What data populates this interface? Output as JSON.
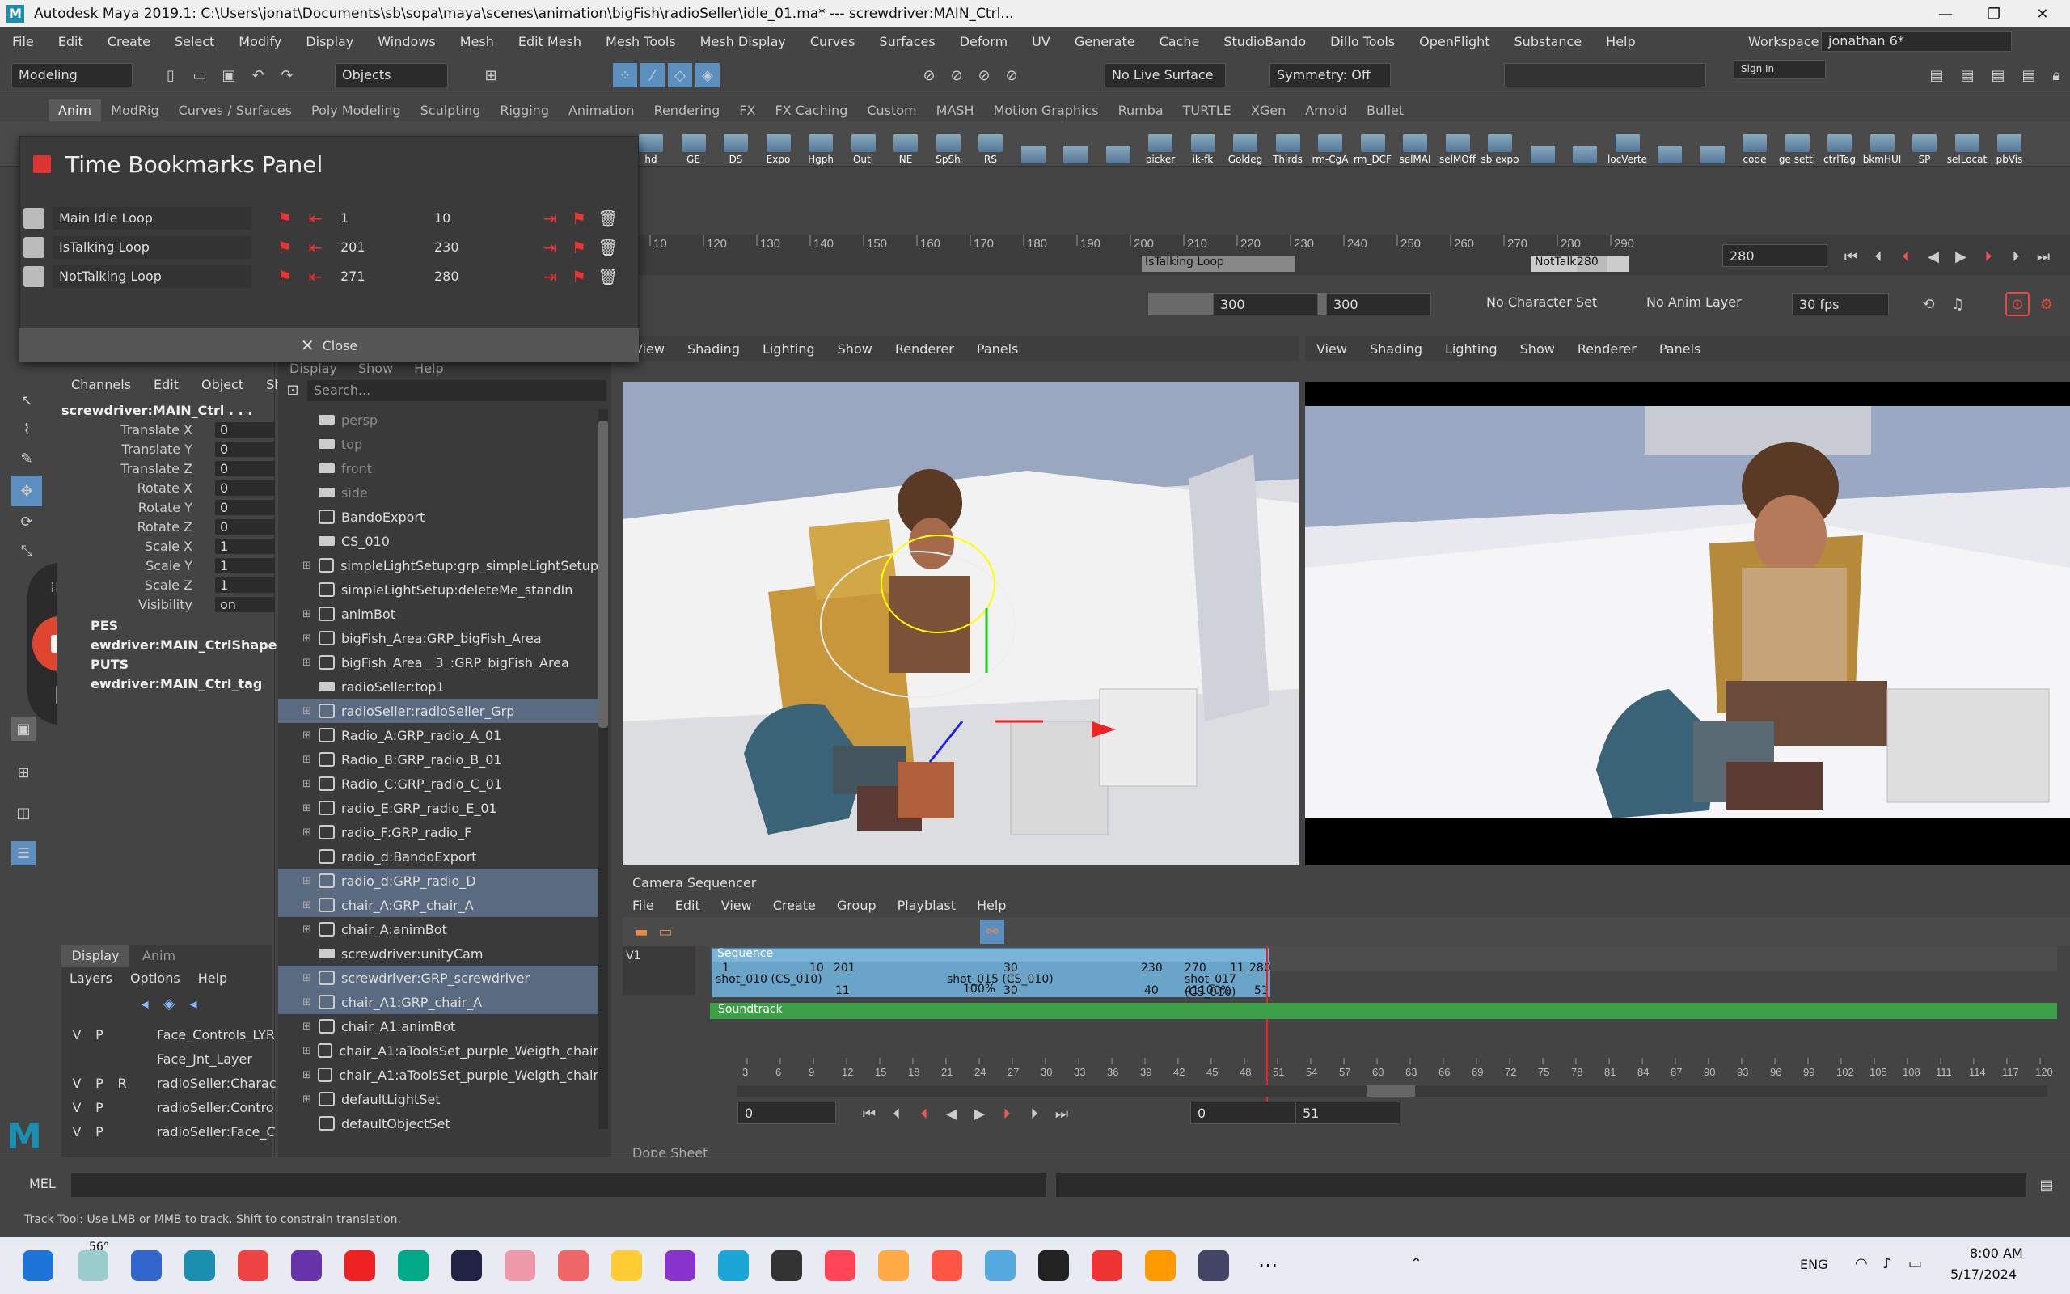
{
  "window": {
    "title": "Autodesk Maya 2019.1: C:\\Users\\jonat\\Documents\\sb\\sopa\\maya\\scenes\\animation\\bigFish\\radioSeller\\idle_01.ma*   ---   screwdriver:MAIN_Ctrl...",
    "minimize": "—",
    "maximize": "❐",
    "close": "✕"
  },
  "menu": [
    "File",
    "Edit",
    "Create",
    "Select",
    "Modify",
    "Display",
    "Windows",
    "Mesh",
    "Edit Mesh",
    "Mesh Tools",
    "Mesh Display",
    "Curves",
    "Surfaces",
    "Deform",
    "UV",
    "Generate",
    "Cache",
    "StudioBando",
    "Dillo Tools",
    "OpenFlight",
    "Substance",
    "Help"
  ],
  "workspace": {
    "label": "Workspace :",
    "value": "jonathan 6*"
  },
  "status": {
    "mode": "Modeling",
    "selection": "Objects",
    "live": "No Live Surface",
    "symmetry": "Symmetry: Off",
    "signin": "Sign In"
  },
  "shelf_tabs": [
    "Anim",
    "ModRig",
    "Curves / Surfaces",
    "Poly Modeling",
    "Sculpting",
    "Rigging",
    "Animation",
    "Rendering",
    "FX",
    "FX Caching",
    "Custom",
    "MASH",
    "Motion Graphics",
    "Rumba",
    "TURTLE",
    "XGen",
    "Arnold",
    "Bullet"
  ],
  "shelf_buttons": [
    "hd",
    "GE",
    "DS",
    "Expo",
    "Hgph",
    "Outl",
    "NE",
    "SpSh",
    "RS",
    "",
    "",
    "",
    "picker",
    "ik-fk",
    "Goldeg",
    "Thirds",
    "rm-CgA",
    "rm_DCF",
    "selMAI",
    "selMOff",
    "sb expo",
    "",
    "",
    "locVerte",
    "",
    "",
    "code",
    "ge setti",
    "ctrlTag",
    "bkmHUI",
    "SP",
    "selLocat",
    "pbVis"
  ],
  "bookmarks": {
    "title": "Time Bookmarks Panel",
    "close": "Close",
    "rows": [
      {
        "name": "Main Idle Loop",
        "start": "1",
        "end": "10"
      },
      {
        "name": "IsTalking Loop",
        "start": "201",
        "end": "230"
      },
      {
        "name": "NotTalking Loop",
        "start": "271",
        "end": "280"
      }
    ]
  },
  "timeslider": {
    "ticks": [
      "10",
      "120",
      "130",
      "140",
      "150",
      "160",
      "170",
      "180",
      "190",
      "200",
      "210",
      "220",
      "230",
      "240",
      "250",
      "260",
      "270",
      "280",
      "290"
    ],
    "bm1": "IsTalking Loop",
    "bm2": "NotTalki",
    "current": "280",
    "frame_field": "280"
  },
  "range": {
    "end_handle": "300",
    "f1": "300",
    "f2": "300",
    "charset": "No Character Set",
    "animlayer": "No Anim Layer",
    "fps": "30 fps"
  },
  "channelbox": {
    "tabs": [
      "Channels",
      "Edit",
      "Object",
      "Show"
    ],
    "node": "screwdriver:MAIN_Ctrl . . .",
    "channels": [
      {
        "l": "Translate X",
        "v": "0"
      },
      {
        "l": "Translate Y",
        "v": "0"
      },
      {
        "l": "Translate Z",
        "v": "0"
      },
      {
        "l": "Rotate X",
        "v": "0"
      },
      {
        "l": "Rotate Y",
        "v": "0"
      },
      {
        "l": "Rotate Z",
        "v": "0"
      },
      {
        "l": "Scale X",
        "v": "1"
      },
      {
        "l": "Scale Y",
        "v": "1"
      },
      {
        "l": "Scale Z",
        "v": "1"
      },
      {
        "l": "Visibility",
        "v": "on"
      }
    ],
    "shapes": "PES",
    "shape1": "ewdriver:MAIN_CtrlShape",
    "inputs": "PUTS",
    "input1": "ewdriver:MAIN_Ctrl_tag"
  },
  "layers": {
    "tabs": [
      "Display",
      "Anim"
    ],
    "menu": [
      "Layers",
      "Options",
      "Help"
    ],
    "rows": [
      {
        "v": "V",
        "p": "P",
        "r": "",
        "name": "Face_Controls_LYR"
      },
      {
        "v": "",
        "p": "",
        "r": "",
        "name": "Face_Jnt_Layer"
      },
      {
        "v": "V",
        "p": "P",
        "r": "R",
        "name": "radioSeller:Charac"
      },
      {
        "v": "V",
        "p": "P",
        "r": "",
        "name": "radioSeller:Contro"
      },
      {
        "v": "V",
        "p": "P",
        "r": "",
        "name": "radioSeller:Face_C"
      }
    ]
  },
  "outliner": {
    "menu": [
      "Display",
      "Show",
      "Help"
    ],
    "search": "Search...",
    "items": [
      {
        "name": "persp",
        "plus": false,
        "cam": true,
        "dim": true,
        "sel": false
      },
      {
        "name": "top",
        "plus": false,
        "cam": true,
        "dim": true,
        "sel": false
      },
      {
        "name": "front",
        "plus": false,
        "cam": true,
        "dim": true,
        "sel": false
      },
      {
        "name": "side",
        "plus": false,
        "cam": true,
        "dim": true,
        "sel": false
      },
      {
        "name": "BandoExport",
        "plus": false,
        "cam": false,
        "dim": false,
        "sel": false
      },
      {
        "name": "CS_010",
        "plus": false,
        "cam": true,
        "dim": false,
        "sel": false
      },
      {
        "name": "simpleLightSetup:grp_simpleLightSetup",
        "plus": true,
        "cam": false,
        "dim": false,
        "sel": false
      },
      {
        "name": "simpleLightSetup:deleteMe_standIn",
        "plus": false,
        "cam": false,
        "dim": false,
        "sel": false
      },
      {
        "name": "animBot",
        "plus": true,
        "cam": false,
        "dim": false,
        "sel": false
      },
      {
        "name": "bigFish_Area:GRP_bigFish_Area",
        "plus": true,
        "cam": false,
        "dim": false,
        "sel": false
      },
      {
        "name": "bigFish_Area__3_:GRP_bigFish_Area",
        "plus": true,
        "cam": false,
        "dim": false,
        "sel": false
      },
      {
        "name": "radioSeller:top1",
        "plus": false,
        "cam": true,
        "dim": false,
        "sel": false
      },
      {
        "name": "radioSeller:radioSeller_Grp",
        "plus": true,
        "cam": false,
        "dim": false,
        "sel": true
      },
      {
        "name": "Radio_A:GRP_radio_A_01",
        "plus": true,
        "cam": false,
        "dim": false,
        "sel": false
      },
      {
        "name": "Radio_B:GRP_radio_B_01",
        "plus": true,
        "cam": false,
        "dim": false,
        "sel": false
      },
      {
        "name": "Radio_C:GRP_radio_C_01",
        "plus": true,
        "cam": false,
        "dim": false,
        "sel": false
      },
      {
        "name": "radio_E:GRP_radio_E_01",
        "plus": true,
        "cam": false,
        "dim": false,
        "sel": false
      },
      {
        "name": "radio_F:GRP_radio_F",
        "plus": true,
        "cam": false,
        "dim": false,
        "sel": false
      },
      {
        "name": "radio_d:BandoExport",
        "plus": false,
        "cam": false,
        "dim": false,
        "sel": false
      },
      {
        "name": "radio_d:GRP_radio_D",
        "plus": true,
        "cam": false,
        "dim": false,
        "sel": true
      },
      {
        "name": "chair_A:GRP_chair_A",
        "plus": true,
        "cam": false,
        "dim": false,
        "sel": true
      },
      {
        "name": "chair_A:animBot",
        "plus": true,
        "cam": false,
        "dim": false,
        "sel": false
      },
      {
        "name": "screwdriver:unityCam",
        "plus": false,
        "cam": true,
        "dim": false,
        "sel": false
      },
      {
        "name": "screwdriver:GRP_screwdriver",
        "plus": true,
        "cam": false,
        "dim": false,
        "sel": true
      },
      {
        "name": "chair_A1:GRP_chair_A",
        "plus": true,
        "cam": false,
        "dim": false,
        "sel": true
      },
      {
        "name": "chair_A1:animBot",
        "plus": true,
        "cam": false,
        "dim": false,
        "sel": false
      },
      {
        "name": "chair_A1:aToolsSet_purple_Weigth_chair",
        "plus": true,
        "cam": false,
        "dim": false,
        "sel": false
      },
      {
        "name": "chair_A1:aToolsSet_purple_Weigth_chair",
        "plus": true,
        "cam": false,
        "dim": false,
        "sel": false
      },
      {
        "name": "defaultLightSet",
        "plus": true,
        "cam": false,
        "dim": false,
        "sel": false
      },
      {
        "name": "defaultObjectSet",
        "plus": false,
        "cam": false,
        "dim": false,
        "sel": false
      }
    ]
  },
  "viewport_menu": [
    "View",
    "Shading",
    "Lighting",
    "Show",
    "Renderer",
    "Panels"
  ],
  "sequencer": {
    "title": "Camera Sequencer",
    "menu": [
      "File",
      "Edit",
      "View",
      "Create",
      "Group",
      "Playblast",
      "Help"
    ],
    "track": "V1",
    "sequence": "Sequence",
    "soundtrack": "Soundtrack",
    "shots": [
      {
        "a": "1",
        "b": "10",
        "name": "shot_010 (CS_010)",
        "c": "10",
        "d": "10",
        "e": "201",
        "f": "11"
      },
      {
        "name": "shot_015 (CS_010)",
        "p": "100%",
        "c": "30",
        "d": "30",
        "e": "230",
        "f": "40"
      },
      {
        "name": "shot_017 (CS_010)",
        "p": "41100%",
        "a": "270",
        "b": "11",
        "c": "280",
        "d": "51"
      }
    ],
    "ticks": [
      "3",
      "6",
      "9",
      "12",
      "15",
      "18",
      "21",
      "24",
      "27",
      "30",
      "33",
      "36",
      "39",
      "42",
      "45",
      "48",
      "51",
      "54",
      "57",
      "60",
      "63",
      "66",
      "69",
      "72",
      "75",
      "78",
      "81",
      "84",
      "87",
      "90",
      "93",
      "96",
      "99",
      "102",
      "105",
      "108",
      "111",
      "114",
      "117",
      "120"
    ],
    "range_start": "0",
    "range_a": "0",
    "range_b": "51",
    "dope": "Dope Sheet"
  },
  "cmd": {
    "label": "MEL",
    "help": "Track Tool: Use LMB or MMB to track. Shift to constrain translation."
  },
  "taskbar": {
    "temp": "56°",
    "lang": "ENG",
    "time": "8:00 AM",
    "date": "5/17/2024"
  },
  "colors": {
    "accent": "#5a6a80",
    "record": "#e8472e",
    "bookmark": "#d33333"
  }
}
